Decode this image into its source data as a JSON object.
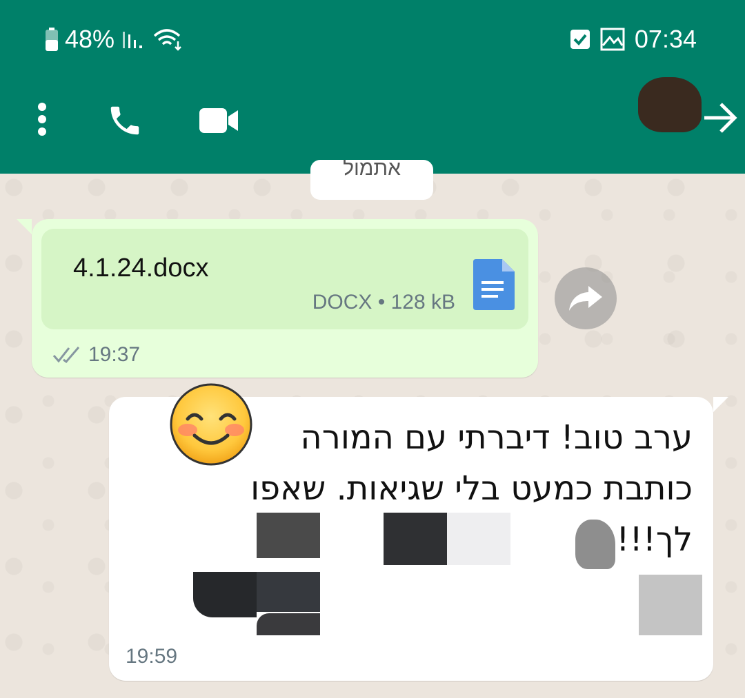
{
  "status_bar": {
    "battery": "48%",
    "time": "07:34"
  },
  "header": {
    "menu_icon": "more-vert-icon",
    "call_icon": "phone-icon",
    "video_icon": "video-call-icon",
    "back_icon": "arrow-right-icon"
  },
  "chat": {
    "date_chip": "אתמול",
    "document_message": {
      "file_name": "4.1.24.docx",
      "meta": "DOCX • 128 kB",
      "time": "19:37",
      "status_icon": "double-check-icon"
    },
    "text_message": {
      "line1": "ערב טוב! דיברתי עם המורה",
      "line2": "כותבת כמעט בלי שגיאות.  שאפו",
      "line3": "לך!!!",
      "emoji": "smiling-face-emoji",
      "time": "19:59"
    }
  },
  "colors": {
    "header": "#008069",
    "outgoing_bubble": "#e7ffdb",
    "incoming_bubble": "#ffffff",
    "doc_icon": "#4a90e2"
  }
}
